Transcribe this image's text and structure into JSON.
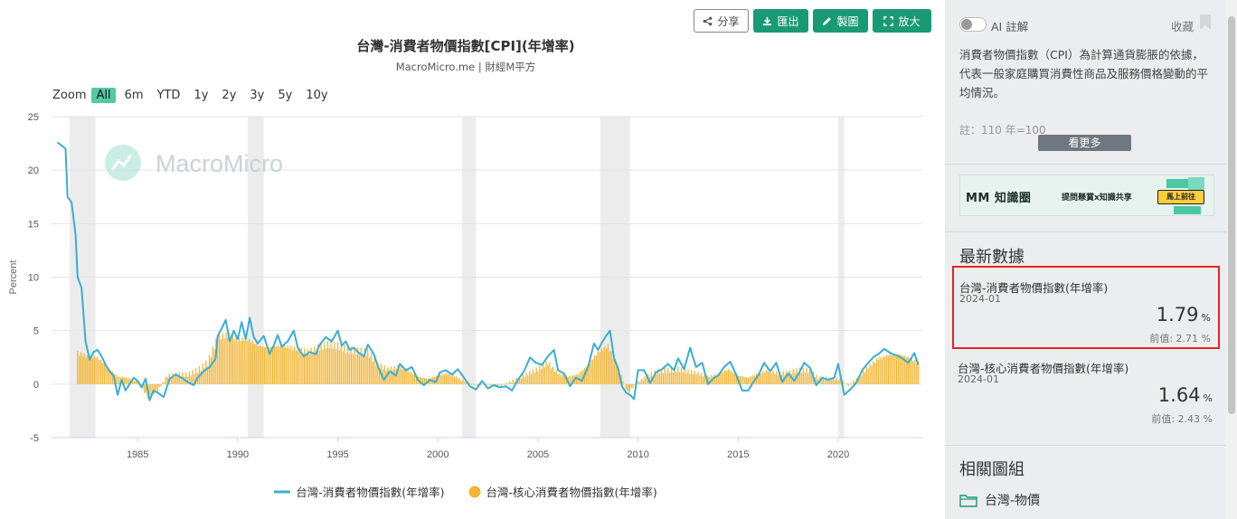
{
  "toolbar": {
    "share_label": "分享",
    "export_label": "匯出",
    "draw_label": "製圖",
    "expand_label": "放大"
  },
  "zoom": {
    "label": "Zoom",
    "options": [
      "All",
      "6m",
      "YTD",
      "1y",
      "2y",
      "3y",
      "5y",
      "10y"
    ],
    "active": "All"
  },
  "watermark": "MacroMicro",
  "colors": {
    "cpi_line": "#3aaed3",
    "core_bar": "#f0b63a",
    "recession": "#ececec",
    "accent": "#1a9a74",
    "zoom_active": "#54c9a6",
    "highlight": "#e02525"
  },
  "chart_data": {
    "type": "line",
    "title": "台灣-消費者物價指數[CPI](年增率)",
    "subtitle": "MacroMicro.me | 財經M平方",
    "ylabel": "Percent",
    "ylim": [
      -5,
      25
    ],
    "yticks": [
      -5,
      0,
      5,
      10,
      15,
      20,
      25
    ],
    "xlim": [
      1980.7,
      2024.2
    ],
    "xticks": [
      1985,
      1990,
      1995,
      2000,
      2005,
      2010,
      2015,
      2020
    ],
    "grid": true,
    "legend_position": "bottom-center",
    "recessions": [
      [
        1981.6,
        1982.9
      ],
      [
        1990.5,
        1991.3
      ],
      [
        2001.2,
        2001.9
      ],
      [
        2008.1,
        2009.6
      ],
      [
        2020.0,
        2020.3
      ]
    ],
    "series": [
      {
        "name": "台灣-消費者物價指數(年增率)",
        "kind": "line",
        "points": [
          [
            1981.0,
            22.6
          ],
          [
            1981.2,
            22.3
          ],
          [
            1981.4,
            22.0
          ],
          [
            1981.5,
            17.5
          ],
          [
            1981.7,
            17.0
          ],
          [
            1981.9,
            14.0
          ],
          [
            1982.0,
            10.0
          ],
          [
            1982.2,
            9.0
          ],
          [
            1982.4,
            4.0
          ],
          [
            1982.6,
            2.3
          ],
          [
            1982.8,
            3.0
          ],
          [
            1983.0,
            3.2
          ],
          [
            1983.2,
            2.6
          ],
          [
            1983.4,
            1.8
          ],
          [
            1983.6,
            1.2
          ],
          [
            1983.8,
            0.8
          ],
          [
            1984.0,
            -1.0
          ],
          [
            1984.2,
            0.4
          ],
          [
            1984.4,
            -0.6
          ],
          [
            1984.6,
            0.0
          ],
          [
            1984.8,
            0.6
          ],
          [
            1985.0,
            0.3
          ],
          [
            1985.2,
            -0.3
          ],
          [
            1985.4,
            0.5
          ],
          [
            1985.6,
            -1.5
          ],
          [
            1985.8,
            -0.6
          ],
          [
            1986.0,
            -0.8
          ],
          [
            1986.3,
            -1.2
          ],
          [
            1986.6,
            0.5
          ],
          [
            1986.9,
            0.9
          ],
          [
            1987.2,
            0.6
          ],
          [
            1987.5,
            0.2
          ],
          [
            1987.8,
            -0.1
          ],
          [
            1988.0,
            0.6
          ],
          [
            1988.3,
            1.2
          ],
          [
            1988.6,
            1.6
          ],
          [
            1988.9,
            2.4
          ],
          [
            1989.0,
            4.5
          ],
          [
            1989.2,
            5.2
          ],
          [
            1989.4,
            6.0
          ],
          [
            1989.6,
            4.0
          ],
          [
            1989.8,
            5.0
          ],
          [
            1990.0,
            4.2
          ],
          [
            1990.2,
            5.8
          ],
          [
            1990.4,
            4.2
          ],
          [
            1990.6,
            6.2
          ],
          [
            1990.8,
            4.4
          ],
          [
            1991.0,
            3.8
          ],
          [
            1991.3,
            4.5
          ],
          [
            1991.6,
            2.8
          ],
          [
            1991.8,
            3.6
          ],
          [
            1992.0,
            4.6
          ],
          [
            1992.2,
            3.5
          ],
          [
            1992.5,
            4.0
          ],
          [
            1992.8,
            5.0
          ],
          [
            1993.0,
            3.4
          ],
          [
            1993.3,
            2.6
          ],
          [
            1993.6,
            3.0
          ],
          [
            1993.9,
            2.8
          ],
          [
            1994.1,
            3.7
          ],
          [
            1994.4,
            4.4
          ],
          [
            1994.7,
            4.0
          ],
          [
            1995.0,
            5.0
          ],
          [
            1995.2,
            3.6
          ],
          [
            1995.4,
            4.0
          ],
          [
            1995.6,
            3.2
          ],
          [
            1995.8,
            3.4
          ],
          [
            1996.0,
            3.0
          ],
          [
            1996.3,
            2.6
          ],
          [
            1996.5,
            3.7
          ],
          [
            1996.8,
            2.8
          ],
          [
            1997.0,
            1.7
          ],
          [
            1997.3,
            0.4
          ],
          [
            1997.6,
            1.2
          ],
          [
            1997.9,
            0.8
          ],
          [
            1998.1,
            1.9
          ],
          [
            1998.4,
            1.3
          ],
          [
            1998.7,
            1.6
          ],
          [
            1999.0,
            0.4
          ],
          [
            1999.3,
            -0.1
          ],
          [
            1999.6,
            0.4
          ],
          [
            1999.9,
            0.2
          ],
          [
            2000.1,
            1.1
          ],
          [
            2000.4,
            1.3
          ],
          [
            2000.7,
            0.9
          ],
          [
            2001.0,
            1.4
          ],
          [
            2001.3,
            0.6
          ],
          [
            2001.6,
            -0.2
          ],
          [
            2001.9,
            -0.5
          ],
          [
            2002.2,
            0.3
          ],
          [
            2002.5,
            -0.4
          ],
          [
            2002.8,
            -0.1
          ],
          [
            2003.1,
            -0.3
          ],
          [
            2003.4,
            -0.2
          ],
          [
            2003.7,
            -0.6
          ],
          [
            2004.0,
            0.4
          ],
          [
            2004.3,
            1.2
          ],
          [
            2004.6,
            2.5
          ],
          [
            2004.9,
            2.0
          ],
          [
            2005.2,
            1.8
          ],
          [
            2005.5,
            2.6
          ],
          [
            2005.8,
            3.2
          ],
          [
            2006.0,
            1.3
          ],
          [
            2006.3,
            1.0
          ],
          [
            2006.6,
            -0.2
          ],
          [
            2006.9,
            0.6
          ],
          [
            2007.2,
            0.3
          ],
          [
            2007.5,
            1.6
          ],
          [
            2007.8,
            3.8
          ],
          [
            2008.0,
            3.2
          ],
          [
            2008.2,
            3.9
          ],
          [
            2008.4,
            4.5
          ],
          [
            2008.6,
            5.0
          ],
          [
            2008.8,
            2.4
          ],
          [
            2009.0,
            1.5
          ],
          [
            2009.2,
            -0.2
          ],
          [
            2009.4,
            -0.8
          ],
          [
            2009.6,
            -1.0
          ],
          [
            2009.8,
            -1.4
          ],
          [
            2010.0,
            1.3
          ],
          [
            2010.3,
            1.3
          ],
          [
            2010.6,
            0.1
          ],
          [
            2010.9,
            1.1
          ],
          [
            2011.2,
            1.4
          ],
          [
            2011.5,
            1.9
          ],
          [
            2011.8,
            1.3
          ],
          [
            2012.0,
            2.4
          ],
          [
            2012.3,
            1.4
          ],
          [
            2012.6,
            3.4
          ],
          [
            2012.9,
            1.6
          ],
          [
            2013.2,
            2.0
          ],
          [
            2013.5,
            0.0
          ],
          [
            2013.8,
            0.6
          ],
          [
            2014.0,
            0.8
          ],
          [
            2014.3,
            1.6
          ],
          [
            2014.6,
            2.1
          ],
          [
            2014.9,
            0.9
          ],
          [
            2015.2,
            -0.6
          ],
          [
            2015.5,
            -0.6
          ],
          [
            2015.8,
            0.3
          ],
          [
            2016.0,
            0.8
          ],
          [
            2016.3,
            2.0
          ],
          [
            2016.6,
            1.2
          ],
          [
            2016.9,
            2.0
          ],
          [
            2017.2,
            0.2
          ],
          [
            2017.5,
            1.0
          ],
          [
            2017.8,
            0.3
          ],
          [
            2018.0,
            0.9
          ],
          [
            2018.3,
            2.0
          ],
          [
            2018.6,
            1.5
          ],
          [
            2018.9,
            -0.1
          ],
          [
            2019.2,
            0.6
          ],
          [
            2019.5,
            0.4
          ],
          [
            2019.8,
            0.6
          ],
          [
            2020.0,
            1.9
          ],
          [
            2020.3,
            -1.0
          ],
          [
            2020.6,
            -0.5
          ],
          [
            2020.9,
            0.1
          ],
          [
            2021.2,
            1.3
          ],
          [
            2021.5,
            2.0
          ],
          [
            2021.8,
            2.6
          ],
          [
            2022.0,
            2.8
          ],
          [
            2022.3,
            3.3
          ],
          [
            2022.6,
            2.9
          ],
          [
            2022.9,
            2.7
          ],
          [
            2023.2,
            2.4
          ],
          [
            2023.5,
            2.0
          ],
          [
            2023.8,
            2.9
          ],
          [
            2024.0,
            1.8
          ]
        ]
      },
      {
        "name": "台灣-核心消費者物價指數(年增率)",
        "kind": "bar",
        "points": [
          [
            1982.0,
            2.9
          ],
          [
            1982.5,
            2.6
          ],
          [
            1983.0,
            2.5
          ],
          [
            1983.5,
            1.6
          ],
          [
            1984.0,
            0.7
          ],
          [
            1984.5,
            0.6
          ],
          [
            1985.0,
            0.2
          ],
          [
            1985.5,
            -1.2
          ],
          [
            1986.0,
            -0.6
          ],
          [
            1986.5,
            0.8
          ],
          [
            1987.0,
            0.9
          ],
          [
            1987.5,
            0.9
          ],
          [
            1988.0,
            1.3
          ],
          [
            1988.5,
            2.0
          ],
          [
            1989.0,
            4.4
          ],
          [
            1989.5,
            4.6
          ],
          [
            1990.0,
            4.2
          ],
          [
            1990.5,
            4.2
          ],
          [
            1991.0,
            3.6
          ],
          [
            1991.5,
            3.4
          ],
          [
            1992.0,
            3.6
          ],
          [
            1992.5,
            3.5
          ],
          [
            1993.0,
            3.3
          ],
          [
            1993.5,
            3.0
          ],
          [
            1994.0,
            3.4
          ],
          [
            1994.5,
            3.7
          ],
          [
            1995.0,
            3.6
          ],
          [
            1995.5,
            3.2
          ],
          [
            1996.0,
            3.1
          ],
          [
            1996.5,
            3.0
          ],
          [
            1997.0,
            1.8
          ],
          [
            1997.5,
            1.4
          ],
          [
            1998.0,
            1.6
          ],
          [
            1998.5,
            1.3
          ],
          [
            1999.0,
            0.7
          ],
          [
            1999.5,
            0.5
          ],
          [
            2000.0,
            0.8
          ],
          [
            2000.5,
            1.0
          ],
          [
            2001.0,
            0.6
          ],
          [
            2001.5,
            0.1
          ],
          [
            2002.0,
            -0.1
          ],
          [
            2002.5,
            0.0
          ],
          [
            2003.0,
            -0.2
          ],
          [
            2003.5,
            0.1
          ],
          [
            2004.0,
            0.5
          ],
          [
            2004.5,
            1.0
          ],
          [
            2005.0,
            1.4
          ],
          [
            2005.5,
            2.0
          ],
          [
            2006.0,
            1.0
          ],
          [
            2006.5,
            0.7
          ],
          [
            2007.0,
            0.9
          ],
          [
            2007.5,
            1.8
          ],
          [
            2008.0,
            3.0
          ],
          [
            2008.5,
            3.6
          ],
          [
            2009.0,
            1.5
          ],
          [
            2009.5,
            -0.8
          ],
          [
            2010.0,
            0.2
          ],
          [
            2010.5,
            0.8
          ],
          [
            2011.0,
            1.2
          ],
          [
            2011.5,
            1.3
          ],
          [
            2012.0,
            1.4
          ],
          [
            2012.5,
            1.2
          ],
          [
            2013.0,
            1.0
          ],
          [
            2013.5,
            0.7
          ],
          [
            2014.0,
            0.9
          ],
          [
            2014.5,
            1.4
          ],
          [
            2015.0,
            0.8
          ],
          [
            2015.5,
            0.6
          ],
          [
            2016.0,
            1.0
          ],
          [
            2016.5,
            1.3
          ],
          [
            2017.0,
            1.0
          ],
          [
            2017.5,
            1.1
          ],
          [
            2018.0,
            1.3
          ],
          [
            2018.5,
            1.3
          ],
          [
            2019.0,
            0.6
          ],
          [
            2019.5,
            0.5
          ],
          [
            2020.0,
            0.5
          ],
          [
            2020.5,
            -0.1
          ],
          [
            2021.0,
            0.6
          ],
          [
            2021.5,
            1.6
          ],
          [
            2022.0,
            2.4
          ],
          [
            2022.5,
            2.7
          ],
          [
            2023.0,
            2.8
          ],
          [
            2023.5,
            2.5
          ],
          [
            2024.0,
            2.0
          ]
        ]
      }
    ]
  },
  "sidebar": {
    "ai_label": "AI 註解",
    "collect_label": "收藏",
    "description": "消費者物價指數（CPI）為計算通貨膨脹的依據，代表一般家庭購買消費性商品及服務價格變動的平均情況。",
    "note": "註：110 年=100",
    "more_label": "看更多",
    "banner": {
      "title": "MM 知識圈",
      "subtitle": "提問懸賞x知識共享",
      "button": "馬上前往"
    },
    "latest_title": "最新數據",
    "latest": [
      {
        "name": "台灣-消費者物價指數(年增率)",
        "date": "2024-01",
        "value": "1.79",
        "unit": "%",
        "prev": "前值: 2.71 %"
      },
      {
        "name": "台灣-核心消費者物價指數(年增率)",
        "date": "2024-01",
        "value": "1.64",
        "unit": "%",
        "prev": "前值: 2.43 %"
      }
    ],
    "related_title": "相關圖組",
    "related_item": "台灣-物價"
  }
}
